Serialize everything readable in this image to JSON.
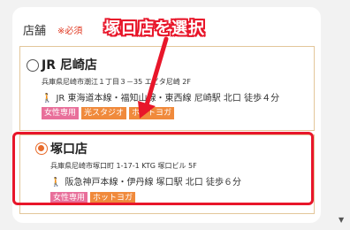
{
  "section": {
    "label": "店舗",
    "required": "※必須"
  },
  "callout": {
    "text": "塚口店を選択"
  },
  "stores": [
    {
      "name": "JR 尼崎店",
      "address": "兵庫県尼崎市潮江１丁目３－35 エビタ尼崎 2F",
      "access": "JR 東海道本線・福知山線・東西線 尼崎駅 北口 徒歩４分",
      "tags": [
        "女性専用",
        "光スタジオ",
        "ホットヨガ"
      ],
      "selected": false
    },
    {
      "name": "塚口店",
      "address": "兵庫県尼崎市塚口町 1-17-1 KTG 塚口ビル 5F",
      "access": "阪急神戸本線・伊丹線 塚口駅 北口 徒歩６分",
      "tags": [
        "女性専用",
        "ホットヨガ"
      ],
      "selected": true
    }
  ],
  "colors": {
    "highlight": "#e8162a",
    "accent": "#e86b2b",
    "tag_pink": "#e86f9a",
    "tag_orange": "#f08a3c"
  },
  "icons": {
    "access": "walking-person-icon",
    "scroll": "scroll-down-arrow-icon"
  }
}
